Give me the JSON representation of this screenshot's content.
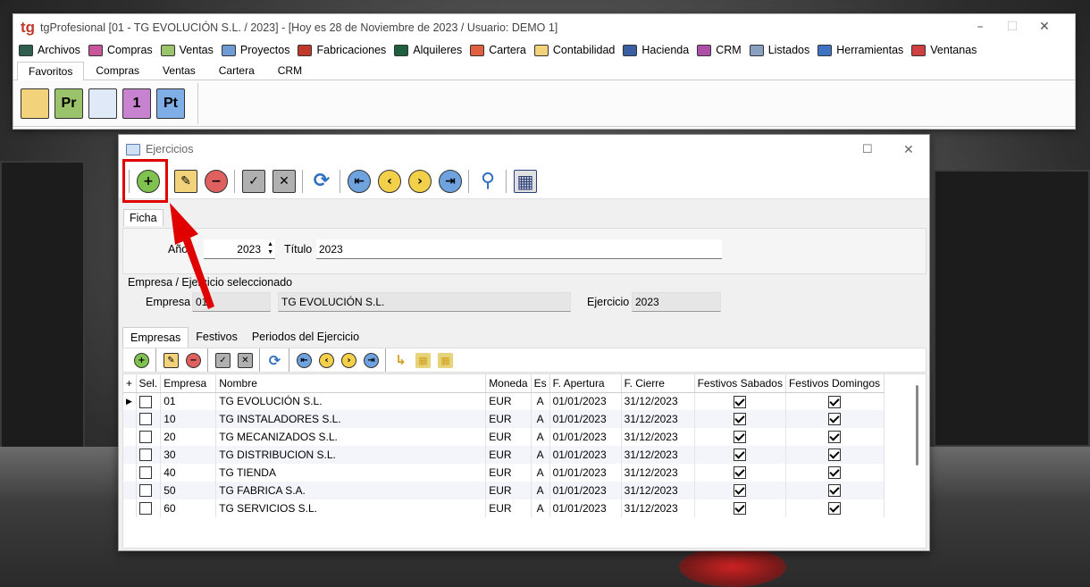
{
  "app": {
    "title": "tgProfesional [01 - TG EVOLUCIÓN S.L. / 2023] - [Hoy es 28 de Noviembre de 2023 / Usuario: DEMO 1]",
    "logo": "tg"
  },
  "menu": [
    {
      "label": "Archivos",
      "icon": "archivos-icon",
      "color": "#2e5e4e"
    },
    {
      "label": "Compras",
      "icon": "compras-icon",
      "color": "#c9559a"
    },
    {
      "label": "Ventas",
      "icon": "ventas-icon",
      "color": "#9bc36b"
    },
    {
      "label": "Proyectos",
      "icon": "proyectos-icon",
      "color": "#6d9bd4"
    },
    {
      "label": "Fabricaciones",
      "icon": "fabricaciones-icon",
      "color": "#c0392b"
    },
    {
      "label": "Alquileres",
      "icon": "alquileres-icon",
      "color": "#1f5f3f"
    },
    {
      "label": "Cartera",
      "icon": "cartera-icon",
      "color": "#e06040"
    },
    {
      "label": "Contabilidad",
      "icon": "contabilidad-icon",
      "color": "#f2d27a"
    },
    {
      "label": "Hacienda",
      "icon": "hacienda-icon",
      "color": "#3a5fa0"
    },
    {
      "label": "CRM",
      "icon": "crm-icon",
      "color": "#b04fa8"
    },
    {
      "label": "Listados",
      "icon": "printer-icon",
      "color": "#8aa0c0"
    },
    {
      "label": "Herramientas",
      "icon": "gear-icon",
      "color": "#3f74c4"
    },
    {
      "label": "Ventanas",
      "icon": "ventanas-icon",
      "color": "#d04040"
    }
  ],
  "ribbon_tabs": [
    "Favoritos",
    "Compras",
    "Ventas",
    "Cartera",
    "CRM"
  ],
  "ribbon_icons": [
    {
      "name": "archive-box-icon",
      "text": "",
      "bg": "#f2d27a"
    },
    {
      "name": "project-icon",
      "text": "Pr",
      "bg": "#9bc36b"
    },
    {
      "name": "presentation-icon",
      "text": "",
      "bg": "#dfe9f7"
    },
    {
      "name": "calendar-icon",
      "text": "1",
      "bg": "#c783cf"
    },
    {
      "name": "pt-icon",
      "text": "Pt",
      "bg": "#7faee6"
    }
  ],
  "ejercicios": {
    "title": "Ejercicios",
    "ficha_tab": "Ficha",
    "anio_label": "Año",
    "anio_value": "2023",
    "titulo_label": "Título",
    "titulo_value": "2023",
    "section_label": "Empresa / Ejercicio seleccionado",
    "empresa_label": "Empresa",
    "empresa_code": "01",
    "empresa_name": "TG EVOLUCIÓN S.L.",
    "ejercicio_label": "Ejercicio",
    "ejercicio_value": "2023",
    "subtabs": [
      "Empresas",
      "Festivos",
      "Periodos del Ejercicio"
    ],
    "columns": [
      "+",
      "Sel.",
      "Empresa",
      "Nombre",
      "Moneda",
      "Es",
      "F. Apertura",
      "F. Cierre",
      "Festivos Sabados",
      "Festivos Domingos"
    ],
    "rows": [
      {
        "empresa": "01",
        "nombre": "TG EVOLUCIÓN S.L.",
        "moneda": "EUR",
        "es": "A",
        "apertura": "01/01/2023",
        "cierre": "31/12/2023",
        "sab": true,
        "dom": true,
        "sel": false
      },
      {
        "empresa": "10",
        "nombre": "TG INSTALADORES S.L.",
        "moneda": "EUR",
        "es": "A",
        "apertura": "01/01/2023",
        "cierre": "31/12/2023",
        "sab": true,
        "dom": true,
        "sel": false
      },
      {
        "empresa": "20",
        "nombre": "TG MECANIZADOS S.L.",
        "moneda": "EUR",
        "es": "A",
        "apertura": "01/01/2023",
        "cierre": "31/12/2023",
        "sab": true,
        "dom": true,
        "sel": false
      },
      {
        "empresa": "30",
        "nombre": "TG DISTRIBUCION S.L.",
        "moneda": "EUR",
        "es": "A",
        "apertura": "01/01/2023",
        "cierre": "31/12/2023",
        "sab": true,
        "dom": true,
        "sel": false
      },
      {
        "empresa": "40",
        "nombre": "TG TIENDA",
        "moneda": "EUR",
        "es": "A",
        "apertura": "01/01/2023",
        "cierre": "31/12/2023",
        "sab": true,
        "dom": true,
        "sel": false
      },
      {
        "empresa": "50",
        "nombre": "TG FABRICA S.A.",
        "moneda": "EUR",
        "es": "A",
        "apertura": "01/01/2023",
        "cierre": "31/12/2023",
        "sab": true,
        "dom": true,
        "sel": false
      },
      {
        "empresa": "60",
        "nombre": "TG SERVICIOS S.L.",
        "moneda": "EUR",
        "es": "A",
        "apertura": "01/01/2023",
        "cierre": "31/12/2023",
        "sab": true,
        "dom": true,
        "sel": false
      }
    ]
  },
  "toolbar_buttons": [
    {
      "name": "add-icon",
      "glyph": "+",
      "bg": "#7fc24f",
      "shape": "circle"
    },
    {
      "name": "edit-icon",
      "glyph": "✎",
      "bg": "#f2d27a",
      "shape": "square"
    },
    {
      "name": "delete-icon",
      "glyph": "−",
      "bg": "#e06060",
      "shape": "circle"
    },
    {
      "name": "accept-icon",
      "glyph": "✓",
      "bg": "#b0b0b0",
      "shape": "square"
    },
    {
      "name": "cancel-icon",
      "glyph": "✕",
      "bg": "#b0b0b0",
      "shape": "square"
    },
    {
      "name": "refresh-icon",
      "glyph": "⟳",
      "bg": "#ffffff",
      "shape": "circle"
    },
    {
      "name": "first-record-icon",
      "glyph": "⇤",
      "bg": "#6fa3e0",
      "shape": "circle"
    },
    {
      "name": "prev-record-icon",
      "glyph": "‹",
      "bg": "#f2d04a",
      "shape": "circle"
    },
    {
      "name": "next-record-icon",
      "glyph": "›",
      "bg": "#f2d04a",
      "shape": "circle"
    },
    {
      "name": "last-record-icon",
      "glyph": "⇥",
      "bg": "#6fa3e0",
      "shape": "circle"
    },
    {
      "name": "search-icon",
      "glyph": "⚲",
      "bg": "#9cc6f2",
      "shape": "circle"
    },
    {
      "name": "grid-view-icon",
      "glyph": "▦",
      "bg": "#e0e0e0",
      "shape": "square"
    }
  ],
  "colors": {
    "highlight": "#e00000",
    "accent": "#c0392b"
  }
}
